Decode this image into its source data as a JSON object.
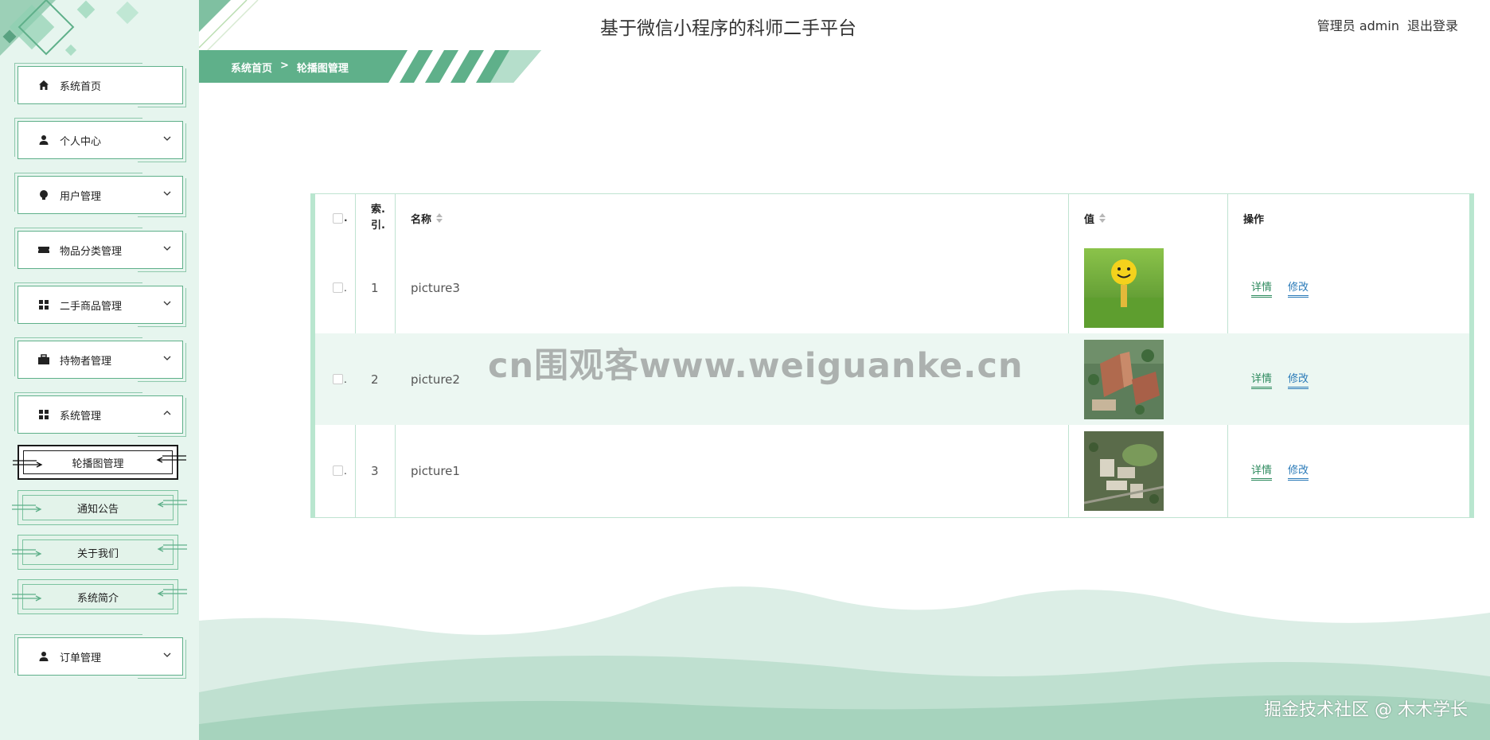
{
  "header": {
    "title": "基于微信小程序的科师二手平台",
    "user_label": "管理员 admin",
    "logout_label": "退出登录"
  },
  "breadcrumb": {
    "home": "系统首页",
    "separator": ">",
    "current": "轮播图管理"
  },
  "sidebar": {
    "items": [
      {
        "label": "系统首页",
        "icon": "home-icon"
      },
      {
        "label": "个人中心",
        "icon": "person-icon"
      },
      {
        "label": "用户管理",
        "icon": "bulb-icon"
      },
      {
        "label": "物品分类管理",
        "icon": "ticket-icon"
      },
      {
        "label": "二手商品管理",
        "icon": "grid-icon"
      },
      {
        "label": "持物者管理",
        "icon": "briefcase-icon"
      },
      {
        "label": "系统管理",
        "icon": "grid-icon"
      },
      {
        "label": "订单管理",
        "icon": "person-icon"
      }
    ],
    "subitems": [
      {
        "label": "轮播图管理",
        "active": true
      },
      {
        "label": "通知公告",
        "active": false
      },
      {
        "label": "关于我们",
        "active": false
      },
      {
        "label": "系统简介",
        "active": false
      }
    ]
  },
  "table": {
    "headers": {
      "select_dot": ".",
      "index": "索.\n引.",
      "name": "名称",
      "value": "值",
      "actions": "操作"
    },
    "rows": [
      {
        "index": "1",
        "name": "picture3",
        "image": "smiley-golf-ball-image"
      },
      {
        "index": "2",
        "name": "picture2",
        "image": "campus-aerial-image"
      },
      {
        "index": "3",
        "name": "picture1",
        "image": "campus-aerial-image-2"
      }
    ],
    "detail_label": "详情",
    "edit_label": "修改"
  },
  "watermark": "cn围观客www.weiguanke.cn",
  "footer_mark": "掘金技术社区 @ 木木学长",
  "colors": {
    "accent": "#5fb08a",
    "sidebar_bg": "#e6f5ee",
    "row_alt": "#ecf7f2",
    "link_detail": "#2d8a5e",
    "link_edit": "#2a7ab8"
  }
}
